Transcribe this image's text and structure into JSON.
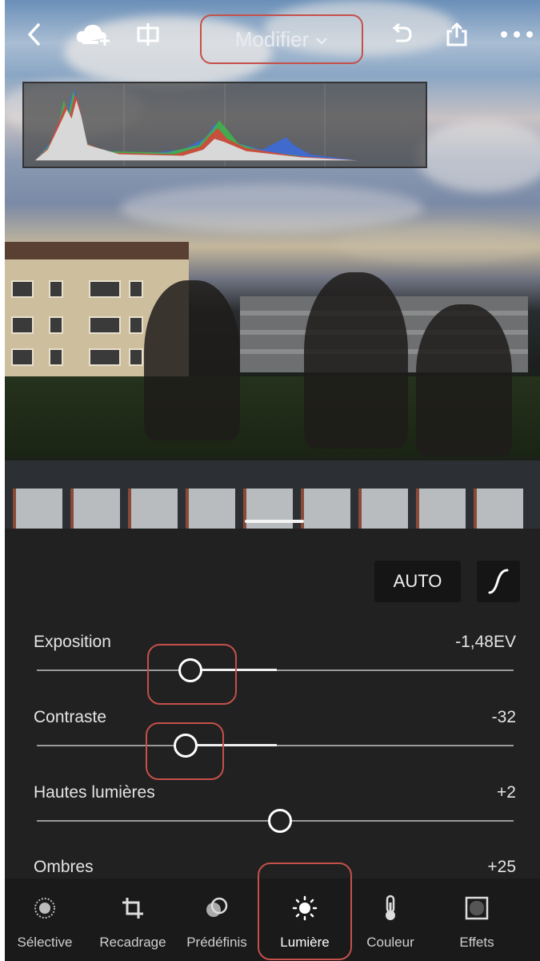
{
  "topbar": {
    "title": "Modifier",
    "icons": [
      "back-icon",
      "cloud-add-icon",
      "compare-icon",
      "chevron-down-icon",
      "undo-icon",
      "share-icon",
      "more-icon"
    ]
  },
  "panel": {
    "auto_label": "AUTO",
    "sliders": [
      {
        "label": "Exposition",
        "value": "-1,48EV",
        "level": 0.33
      },
      {
        "label": "Contraste",
        "value": "-32",
        "level": 0.32
      },
      {
        "label": "Hautes lumières",
        "value": "+2",
        "level": 0.51
      },
      {
        "label": "Ombres",
        "value": "+25"
      }
    ]
  },
  "toolbar": {
    "items": [
      {
        "label": "Sélective",
        "icon": "selective-icon"
      },
      {
        "label": "Recadrage",
        "icon": "crop-icon"
      },
      {
        "label": "Prédéfinis",
        "icon": "presets-icon"
      },
      {
        "label": "Lumière",
        "icon": "light-icon",
        "active": true
      },
      {
        "label": "Couleur",
        "icon": "thermometer-icon"
      },
      {
        "label": "Effets",
        "icon": "effects-icon"
      }
    ]
  },
  "colors": {
    "highlight": "#c5504a",
    "panel_bg": "#212121",
    "toolbar_bg": "#1a1a1a"
  }
}
